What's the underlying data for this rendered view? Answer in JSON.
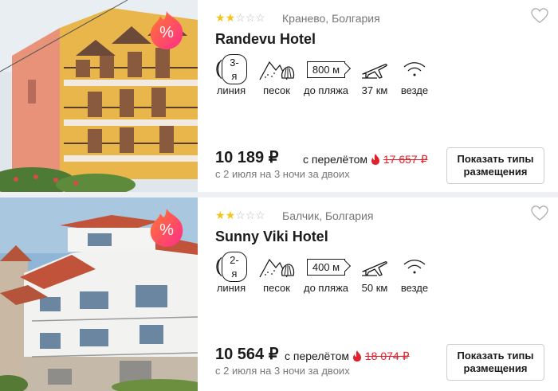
{
  "hotels": [
    {
      "stars": 2,
      "max_stars": 5,
      "location": "Кранево, Болгария",
      "name": "Randevu Hotel",
      "discount_symbol": "%",
      "features": {
        "line_value": "3-я",
        "line_label": "линия",
        "beach_label": "песок",
        "distance_value": "800 м",
        "distance_label": "до пляжа",
        "airport_label": "37 км",
        "wifi_label": "везде"
      },
      "price": "10 189 ₽",
      "flight_text": "с перелётом",
      "old_price": "17 657 ₽",
      "dates": "с 2 июля на 3 ночи за двоих",
      "button_label": "Показать типы размещения"
    },
    {
      "stars": 2,
      "max_stars": 5,
      "location": "Балчик, Болгария",
      "name": "Sunny Viki Hotel",
      "discount_symbol": "%",
      "features": {
        "line_value": "2-я",
        "line_label": "линия",
        "beach_label": "песок",
        "distance_value": "400 м",
        "distance_label": "до пляжа",
        "airport_label": "50 км",
        "wifi_label": "везде"
      },
      "price": "10 564 ₽",
      "flight_text": "с перелётом",
      "old_price": "18 074 ₽",
      "dates": "с 2 июля на 3 ночи за двоих",
      "button_label": "Показать типы размещения"
    }
  ],
  "icons": {
    "star": "star-icon",
    "heart": "heart-icon",
    "discount": "discount-flame-icon",
    "sea_line": "sea-waves-icon",
    "beach": "sand-shell-icon",
    "distance": "signpost-icon",
    "airport": "airplane-icon",
    "wifi": "wifi-icon",
    "hot_deal": "fire-icon"
  },
  "colors": {
    "star_active": "#f5c518",
    "star_inactive": "#bdbdbd",
    "old_price": "#e0212c",
    "badge_gradient_start": "#ff7a2f",
    "badge_gradient_end": "#ff2d8a"
  }
}
